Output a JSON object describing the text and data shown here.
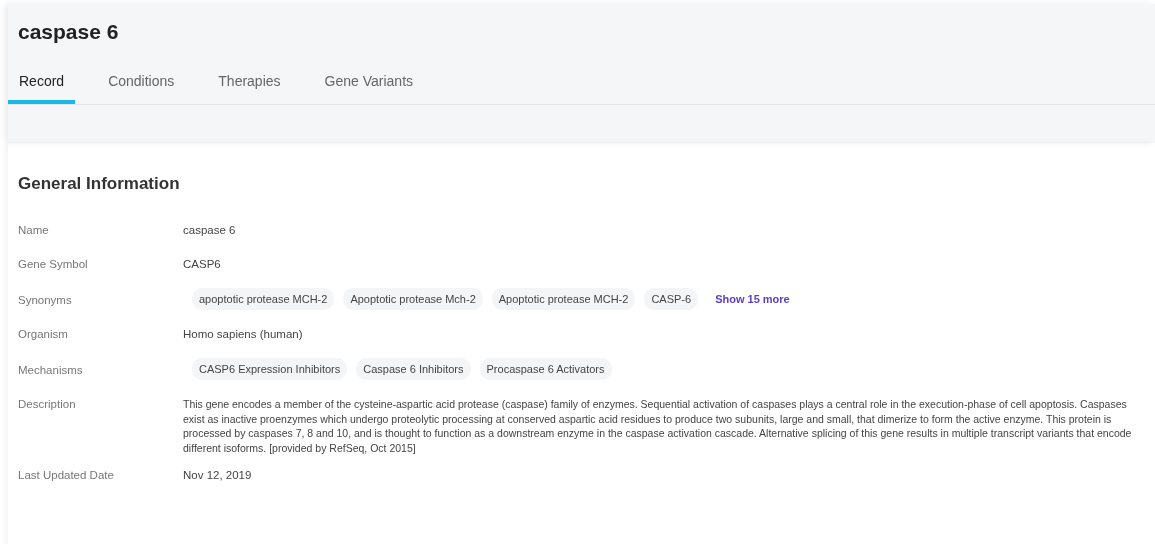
{
  "header": {
    "title": "caspase 6"
  },
  "tabs": [
    {
      "label": "Record",
      "selected": true
    },
    {
      "label": "Conditions",
      "selected": false
    },
    {
      "label": "Therapies",
      "selected": false
    },
    {
      "label": "Gene Variants",
      "selected": false
    }
  ],
  "section": {
    "title": "General Information",
    "fields": [
      {
        "label": "Name",
        "kind": "text",
        "value": "caspase 6"
      },
      {
        "label": "Gene Symbol",
        "kind": "text",
        "value": "CASP6"
      },
      {
        "label": "Synonyms",
        "kind": "chips",
        "chips": [
          "apoptotic protease MCH-2",
          "Apoptotic protease Mch-2",
          "Apoptotic protease MCH-2",
          "CASP-6"
        ],
        "more": "Show 15 more"
      },
      {
        "label": "Organism",
        "kind": "text",
        "value": "Homo sapiens (human)"
      },
      {
        "label": "Mechanisms",
        "kind": "chips",
        "chips": [
          "CASP6 Expression Inhibitors",
          "Caspase 6 Inhibitors",
          "Procaspase 6 Activators"
        ]
      },
      {
        "label": "Description",
        "kind": "paragraph",
        "value": "This gene encodes a member of the cysteine-aspartic acid protease (caspase) family of enzymes. Sequential activation of caspases plays a central role in the execution-phase of cell apoptosis. Caspases exist as inactive proenzymes which undergo proteolytic processing at conserved aspartic acid residues to produce two subunits, large and small, that dimerize to form the active enzyme. This protein is processed by caspases 7, 8 and 10, and is thought to function as a downstream enzyme in the caspase activation cascade. Alternative splicing of this gene results in multiple transcript variants that encode different isoforms. [provided by RefSeq, Oct 2015]"
      },
      {
        "label": "Last Updated Date",
        "kind": "text",
        "value": "Nov 12, 2019"
      }
    ]
  }
}
